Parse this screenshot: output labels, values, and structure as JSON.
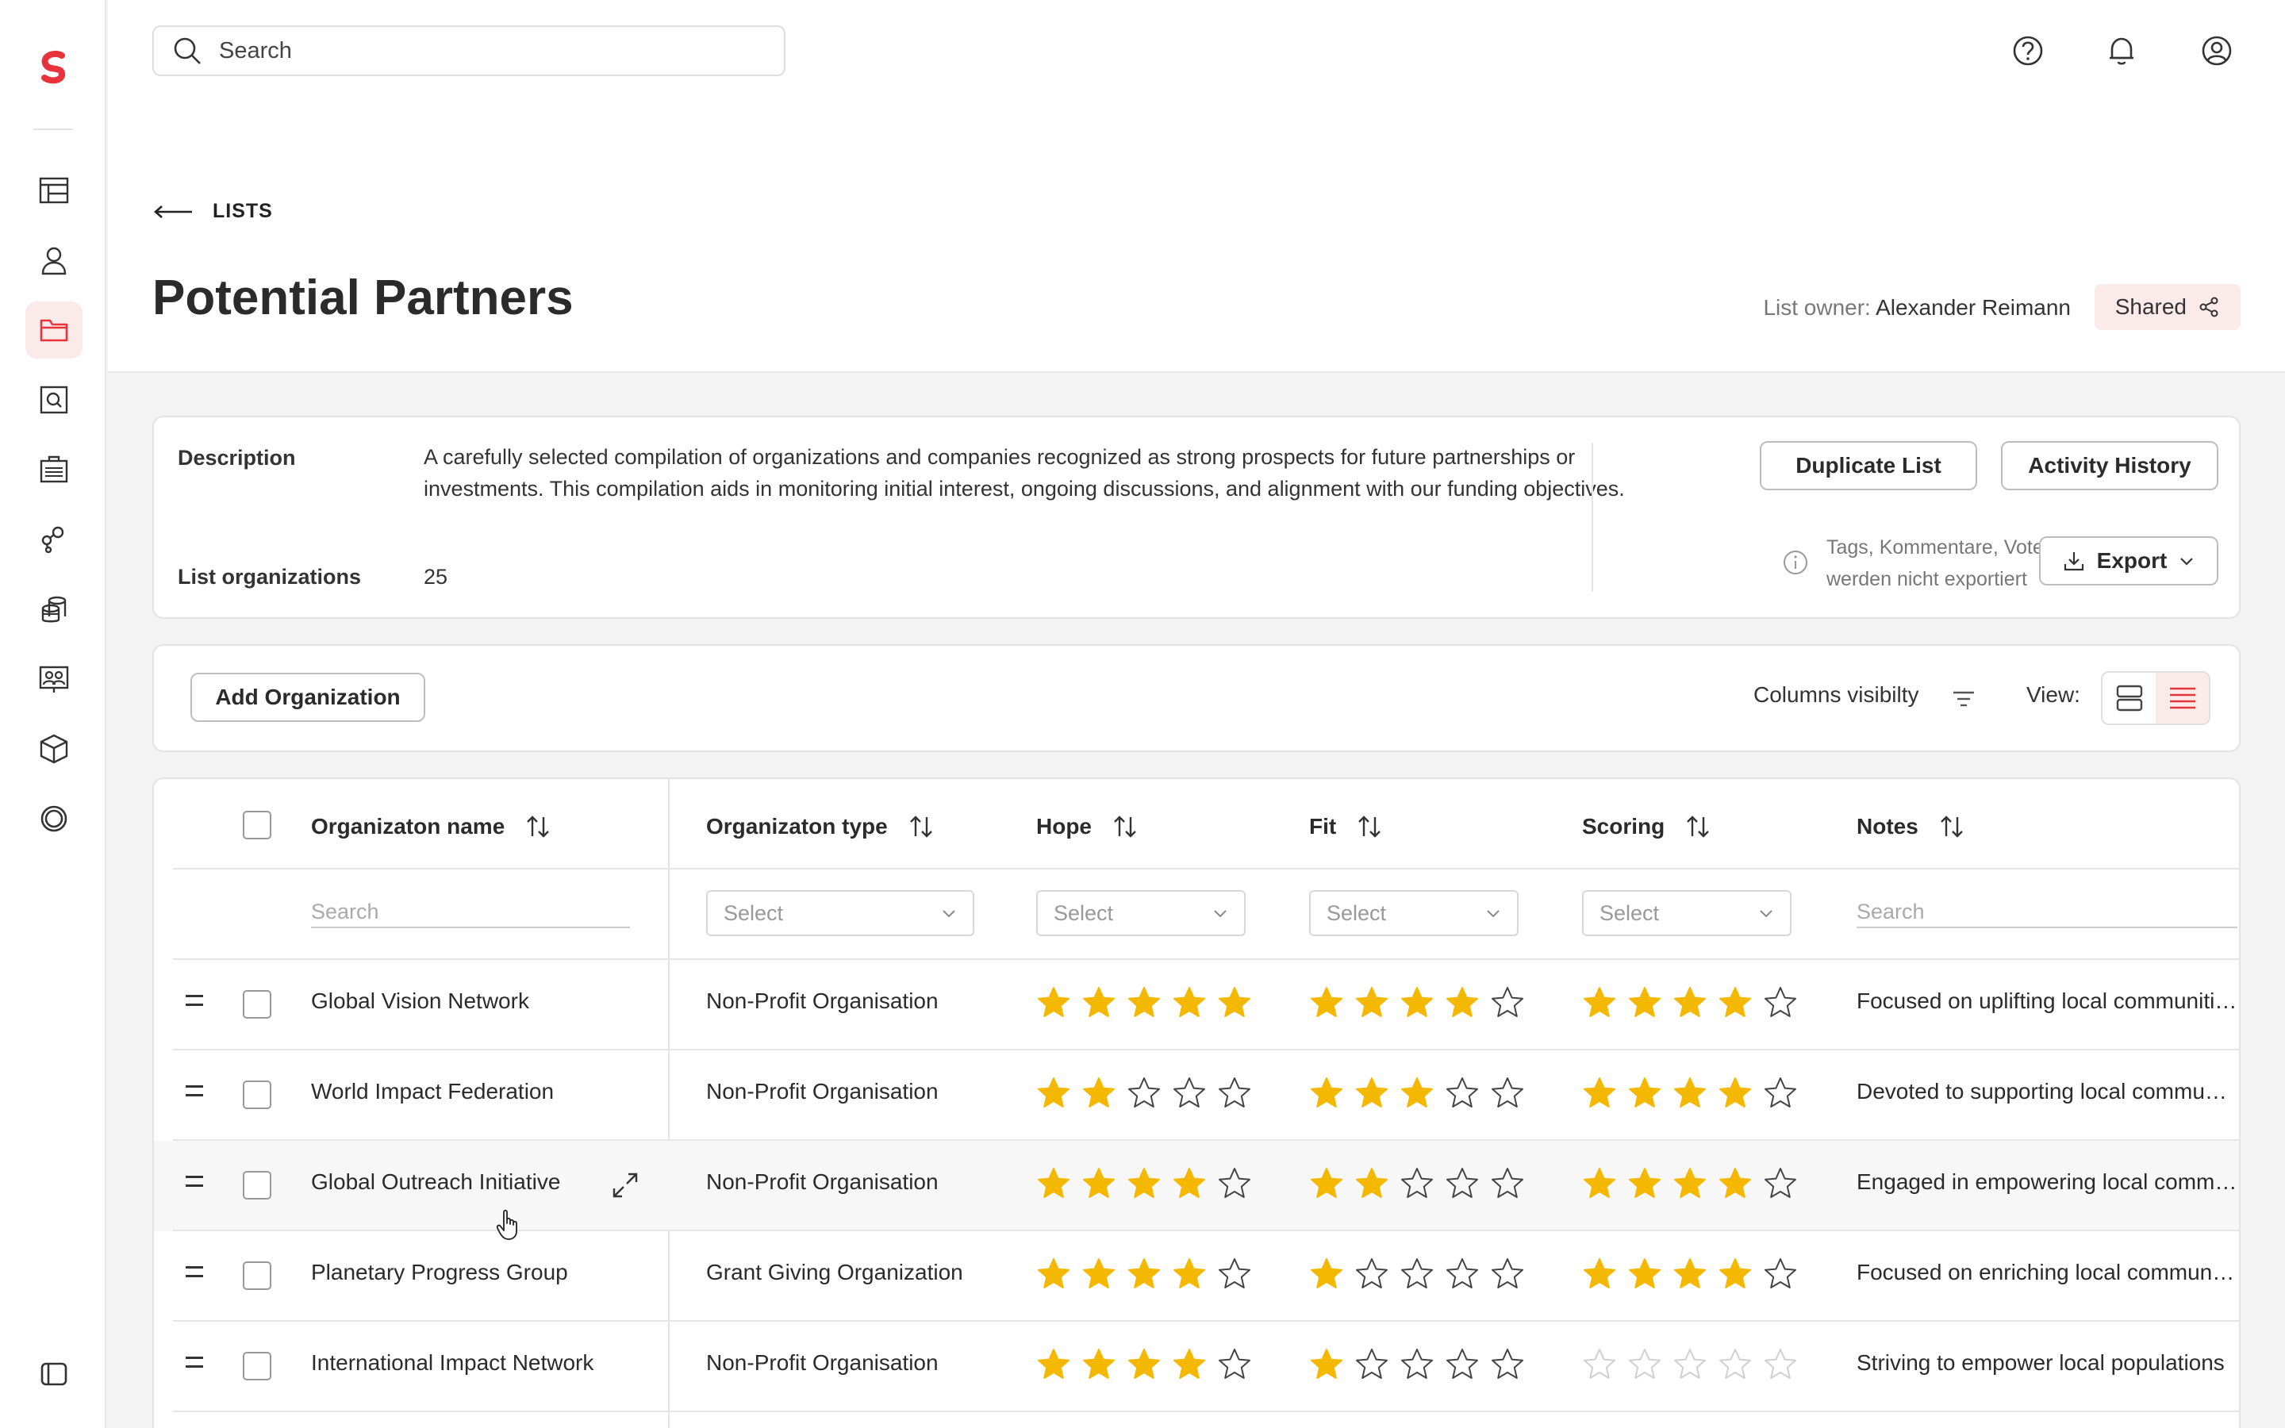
{
  "search": {
    "placeholder": "Search"
  },
  "breadcrumb": {
    "label": "LISTS"
  },
  "page": {
    "title": "Potential Partners",
    "owner_label": "List owner:",
    "owner_name": "Alexander Reimann",
    "shared_label": "Shared"
  },
  "description": {
    "label": "Description",
    "text": "A carefully selected compilation of organizations and companies recognized as strong prospects for future partnerships or investments. This compilation aids in monitoring initial interest, ongoing discussions, and alignment with our funding objectives.",
    "orgs_label": "List organizations",
    "orgs_count": "25",
    "duplicate_label": "Duplicate List",
    "activity_label": "Activity History",
    "export_note": "Tags, Kommentare, Votes werden nicht exportiert",
    "export_label": "Export"
  },
  "toolbar": {
    "add_label": "Add Organization",
    "columns_label": "Columns visibilty",
    "view_label": "View:"
  },
  "table": {
    "headers": {
      "name": "Organizaton name",
      "type": "Organizaton type",
      "hope": "Hope",
      "fit": "Fit",
      "scoring": "Scoring",
      "notes": "Notes"
    },
    "filters": {
      "name_placeholder": "Search",
      "type_placeholder": "Select",
      "hope_placeholder": "Select",
      "fit_placeholder": "Select",
      "scoring_placeholder": "Select",
      "notes_placeholder": "Search"
    },
    "rows": [
      {
        "name": "Global Vision Network",
        "type": "Non-Profit Organisation",
        "hope": 5,
        "fit": 4,
        "scoring": 4,
        "notes": "Focused on uplifting local communities"
      },
      {
        "name": "World Impact Federation",
        "type": "Non-Profit Organisation",
        "hope": 2,
        "fit": 3,
        "scoring": 4,
        "notes": "Devoted to supporting local communities"
      },
      {
        "name": "Global Outreach Initiative",
        "type": "Non-Profit Organisation",
        "hope": 4,
        "fit": 2,
        "scoring": 4,
        "notes": "Engaged in empowering local communities"
      },
      {
        "name": "Planetary Progress Group",
        "type": "Grant Giving Organization",
        "hope": 4,
        "fit": 1,
        "scoring": 4,
        "notes": "Focused on enriching local communities"
      },
      {
        "name": "International Impact Network",
        "type": "Non-Profit Organisation",
        "hope": 4,
        "fit": 1,
        "scoring": 0,
        "notes": "Striving to empower local populations"
      }
    ]
  },
  "colors": {
    "accent": "#e8323c",
    "star": "#f5b800",
    "active_bg": "#fbeaea"
  }
}
